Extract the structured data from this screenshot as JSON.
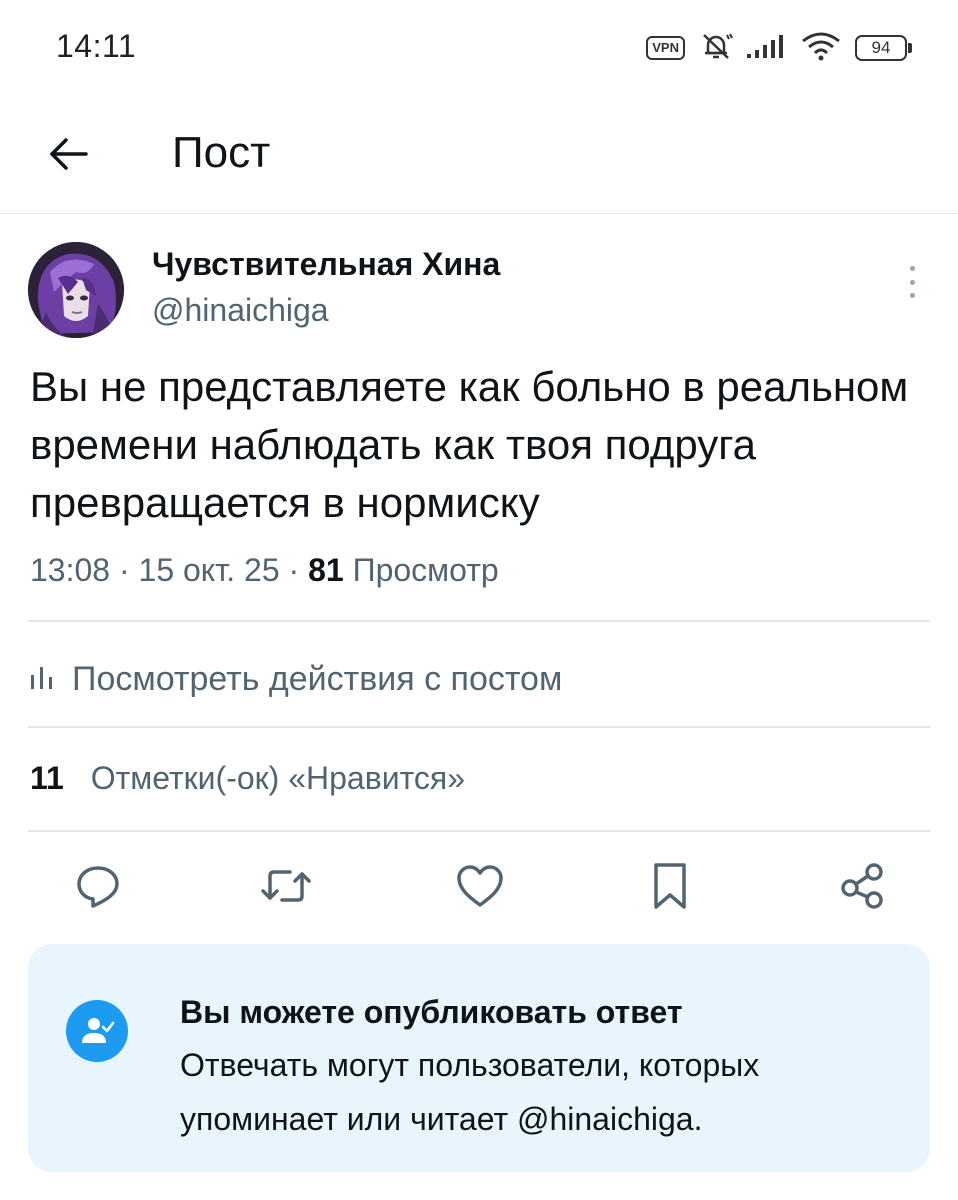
{
  "status_bar": {
    "time": "14:11",
    "vpn": "VPN",
    "battery": "94",
    "icons": [
      "vpn-badge",
      "muted-bell-icon",
      "signal-icon",
      "wifi-icon",
      "battery-icon"
    ]
  },
  "header": {
    "back_icon": "arrow-left-icon",
    "title": "Пост"
  },
  "post": {
    "author_name": "Чувствительная Хина",
    "author_handle": "@hinaichiga",
    "text": "Вы не представляете как больно в реальном времени наблюдать как твоя подруга превращается в нормиску",
    "time": "13:08",
    "date": "15 окт. 25",
    "separator": "·",
    "views_count": "81",
    "views_label": "Просмотр",
    "activity_label": "Посмотреть действия с постом",
    "likes_count": "11",
    "likes_label": "Отметки(-ок) «Нравится»",
    "actions": [
      "reply-icon",
      "retweet-icon",
      "like-icon",
      "bookmark-icon",
      "share-icon"
    ]
  },
  "reply_restriction": {
    "title": "Вы можете опубликовать ответ",
    "description": "Отвечать могут пользователи, которых упоминает или читает @hinaichiga.",
    "icon": "user-check-icon"
  },
  "colors": {
    "text_primary": "#0f1419",
    "text_secondary": "#536471",
    "accent": "#1d9bf0",
    "card_bg": "#e8f5fd",
    "divider": "#e1e6ea"
  }
}
